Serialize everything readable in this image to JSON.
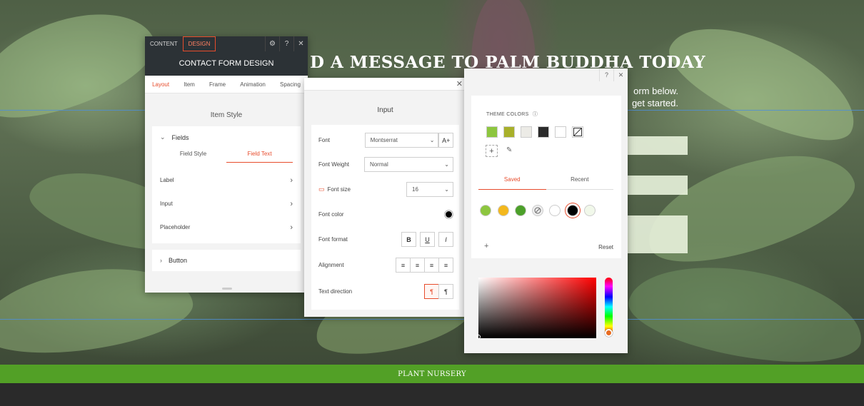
{
  "page": {
    "hero_title": "D A MESSAGE TO PALM BUDDHA TODAY",
    "hero_sub_line1": "orm below.",
    "hero_sub_line2": "get started.",
    "footer_text": "PLANT NURSERY"
  },
  "panel1": {
    "tabs": [
      "CONTENT",
      "DESIGN"
    ],
    "active_tab": "DESIGN",
    "tool_icons": [
      "gear-icon",
      "help-icon",
      "close-icon"
    ],
    "tool_glyphs": [
      "⚙",
      "?",
      "✕"
    ],
    "header": "CONTACT FORM DESIGN",
    "subtabs": [
      "Layout",
      "Item",
      "Frame",
      "Animation",
      "Spacing"
    ],
    "active_subtab": "Layout",
    "section_title": "Item Style",
    "fields_label": "Fields",
    "field_tabs": [
      "Field Style",
      "Field Text"
    ],
    "active_field_tab": "Field Text",
    "rows": [
      "Label",
      "Input",
      "Placeholder"
    ],
    "button_label": "Button",
    "chevron_down": "⌄",
    "chevron_right": "›",
    "row_arrow": "›"
  },
  "panel2": {
    "close": "✕",
    "title": "Input",
    "font": {
      "label": "Font",
      "value": "Montserrat",
      "ai_button": "A+"
    },
    "font_weight": {
      "label": "Font Weight",
      "value": "Normal"
    },
    "font_size": {
      "label": "Font size",
      "value": "16"
    },
    "font_color": {
      "label": "Font color",
      "value": "#000000"
    },
    "font_format": {
      "label": "Font format",
      "buttons": [
        "B",
        "U",
        "I"
      ]
    },
    "alignment": {
      "label": "Alignment",
      "icons": [
        "align-left-icon",
        "align-center-icon",
        "align-right-icon",
        "align-justify-icon"
      ],
      "glyphs": [
        "≡",
        "≡",
        "≡",
        "≡"
      ]
    },
    "text_direction": {
      "label": "Text direction",
      "buttons": [
        "¶",
        "¶"
      ],
      "active_index": 0
    },
    "caret": "⌄"
  },
  "panel3": {
    "tools": [
      "?",
      "✕"
    ],
    "theme_label": "THEME COLORS",
    "info_glyph": "ⓘ",
    "theme_colors": [
      "#8dc63f",
      "#a8b02a",
      "#ecebe6",
      "#2b2b2b",
      "#ffffff",
      "none"
    ],
    "add_glyph": "+",
    "pencil_glyph": "✎",
    "tabs": [
      "Saved",
      "Recent"
    ],
    "active_tab": "Saved",
    "saved_colors": [
      "#8dc63f",
      "#f3b81d",
      "#4ca02a",
      "none",
      "#ffffff",
      "#000000",
      "#f1f8ea"
    ],
    "selected_saved_index": 5,
    "plus": "+",
    "reset": "Reset"
  },
  "colors": {
    "accent": "#e74c2c",
    "dark_header": "#2c3236",
    "footer_green": "#52a026"
  }
}
